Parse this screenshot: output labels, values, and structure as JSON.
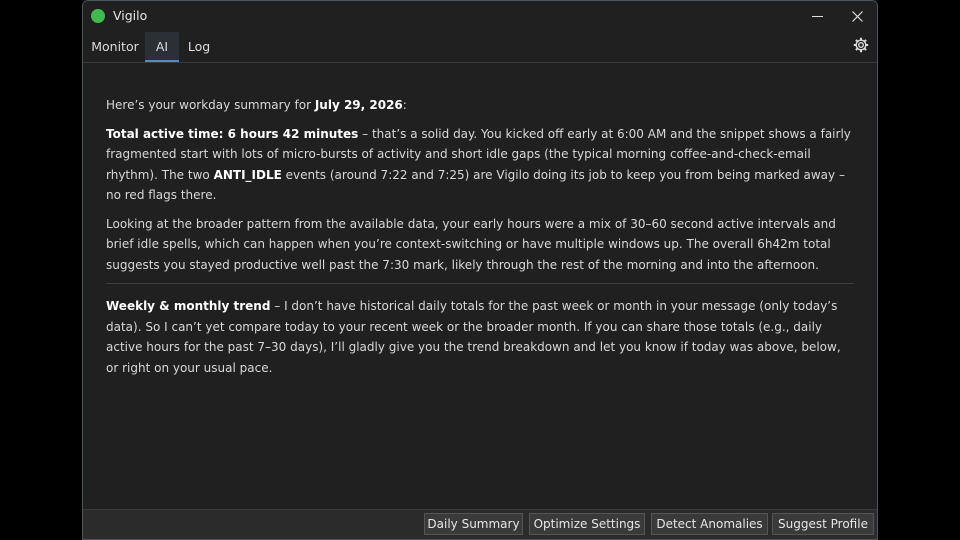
{
  "window": {
    "title": "Vigilo",
    "status_color": "#3fb950"
  },
  "tabs": [
    {
      "label": "Monitor"
    },
    {
      "label": "AI",
      "active": true
    },
    {
      "label": "Log"
    }
  ],
  "content": {
    "intro_prefix": "Here’s your workday summary for ",
    "intro_date": "July 29, 2026",
    "intro_suffix": ":",
    "p1_bold": "Total active time: 6 hours 42 minutes",
    "p1_text_a": " – that’s a solid day. You kicked off early at 6:00 AM and the snippet shows a fairly fragmented start with lots of micro-bursts of activity and short idle gaps (the typical morning coffee-and-check-email rhythm). The two ",
    "p1_bold2": "ANTI_IDLE",
    "p1_text_b": " events (around 7:22 and 7:25) are Vigilo doing its job to keep you from being marked away – no red flags there.",
    "p2": "Looking at the broader pattern from the available data, your early hours were a mix of 30–60 second active intervals and brief idle spells, which can happen when you’re context-switching or have multiple windows up. The overall 6h42m total suggests you stayed productive well past the 7:30 mark, likely through the rest of the morning and into the afternoon.",
    "p3_bold": "Weekly & monthly trend",
    "p3_text": " – I don’t have historical daily totals for the past week or month in your message (only today’s data). So I can’t yet compare today to your recent week or the broader month. If you can share those totals (e.g., daily active hours for the past 7–30 days), I’ll gladly give you the trend breakdown and let you know if today was above, below, or right on your usual pace."
  },
  "actions": {
    "daily_summary": "Daily Summary",
    "optimize_settings": "Optimize Settings",
    "detect_anomalies": "Detect Anomalies",
    "suggest_profile": "Suggest Profile"
  }
}
